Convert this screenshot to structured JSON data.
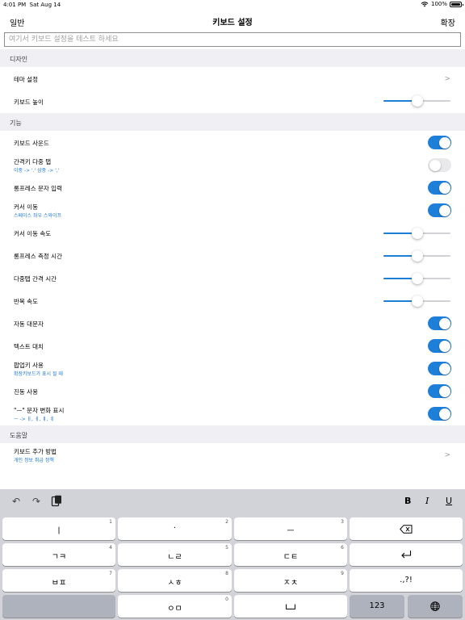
{
  "status": {
    "time": "4:01 PM",
    "date": "Sat Aug 14",
    "battery": "100%"
  },
  "nav": {
    "back": "일반",
    "title": "키보드 설정",
    "action": "확장"
  },
  "test_input": {
    "placeholder": "여기서 키보드 설정을 테스트 하세요",
    "value": ""
  },
  "sections": {
    "design": "디자인",
    "features": "기능",
    "help": "도움말"
  },
  "design_rows": {
    "theme": "테마 설정",
    "height": "키보드 높이",
    "height_value": 0.5
  },
  "feature_rows": {
    "sound": "키보드 사운드",
    "space_double_tap": "간격키 다중 탭",
    "space_double_tap_sub": "이중 -> '.' 삼중 -> ','",
    "long_press_input": "롱프레스 문자 입력",
    "cursor_move": "커서 이동",
    "cursor_move_sub": "스페이스 좌우 스와이프",
    "cursor_speed": "커서 이동 속도",
    "long_press_time": "롱프레스 측정 시간",
    "multi_tap_interval": "다중탭 간격 시간",
    "repeat_speed": "반복 속도",
    "auto_caps": "자동 대문자",
    "text_replace": "텍스트 대치",
    "popup_key": "팝업키 사용",
    "popup_key_sub": "확장키보드가 표시 될 때",
    "vibrate": "진동 사용",
    "char_change": "\"ㅡ\" 문자 변화 표시",
    "char_change_sub": "ㅡ -> ㅐ, ㅔ, ㅒ, ㅖ"
  },
  "toggles": {
    "sound": true,
    "space_double_tap": false,
    "long_press_input": true,
    "cursor_move": true,
    "auto_caps": true,
    "text_replace": true,
    "popup_key": true,
    "vibrate": true,
    "char_change": true
  },
  "slider_values": {
    "cursor_speed": 0.5,
    "long_press_time": 0.5,
    "multi_tap_interval": 0.5,
    "repeat_speed": 0.5
  },
  "help_rows": {
    "add_keyboard": "키보드 추가 방법",
    "add_keyboard_sub": "개인 정보 취급 정책"
  },
  "keyboard": {
    "toolbar": {
      "bold": "B",
      "italic": "I",
      "underline": "U"
    },
    "rows": [
      [
        {
          "label": "ㅣ",
          "num": "1"
        },
        {
          "label": "·",
          "num": "2"
        },
        {
          "label": "ㅡ",
          "num": "3"
        },
        {
          "label": "",
          "num": ""
        }
      ],
      [
        {
          "label": "ㄱㅋ",
          "num": "4"
        },
        {
          "label": "ㄴㄹ",
          "num": "5"
        },
        {
          "label": "ㄷㅌ",
          "num": "6"
        },
        {
          "label": "",
          "num": ""
        }
      ],
      [
        {
          "label": "ㅂㅍ",
          "num": "7"
        },
        {
          "label": "ㅅㅎ",
          "num": "8"
        },
        {
          "label": "ㅈㅊ",
          "num": "9"
        },
        {
          "label": ".,?!",
          "num": ""
        }
      ],
      [
        {
          "label": "",
          "num": ""
        },
        {
          "label": "ㅇㅁ",
          "num": "0"
        },
        {
          "label": "",
          "num": ""
        },
        {
          "label": "123",
          "num": ""
        },
        {
          "label": "",
          "num": ""
        }
      ]
    ]
  }
}
